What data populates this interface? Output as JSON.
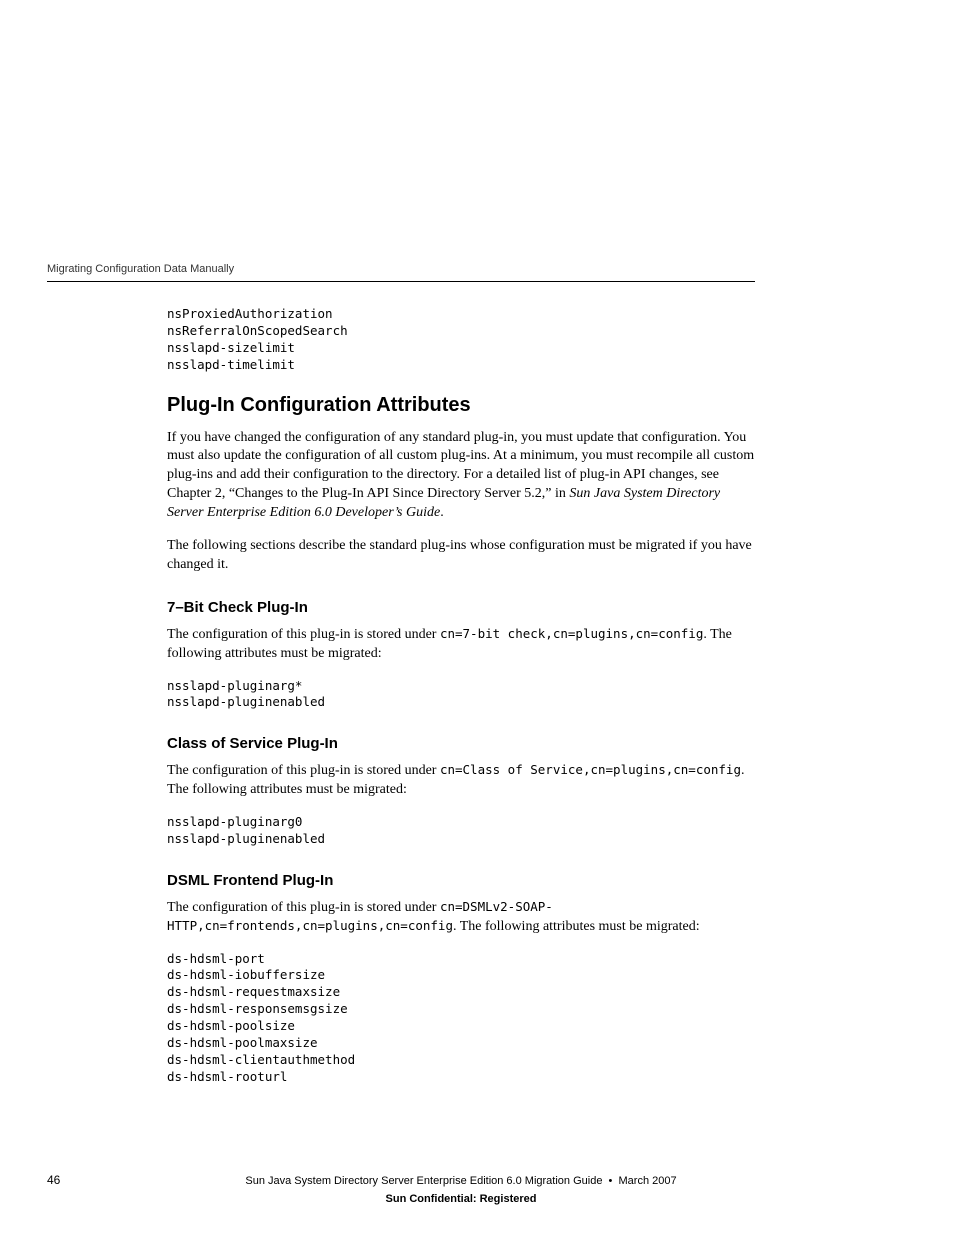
{
  "header": {
    "running_title": "Migrating Configuration Data Manually"
  },
  "top_code": "nsProxiedAuthorization\nnsReferralOnScopedSearch\nnsslapd-sizelimit\nnsslapd-timelimit",
  "section": {
    "title": "Plug-In Configuration Attributes",
    "para1": "If you have changed the configuration of any standard plug-in, you must update that configuration. You must also update the configuration of all custom plug-ins. At a minimum, you must recompile all custom plug-ins and add their configuration to the directory. For a detailed list of plug-in API changes, see Chapter 2, “Changes to the Plug-In API Since Directory Server 5.2,” in ",
    "para1_italic": "Sun Java System Directory Server Enterprise Edition 6.0 Developer’s Guide",
    "para1_tail": ".",
    "para2": "The following sections describe the standard plug-ins whose configuration must be migrated if you have changed it."
  },
  "sub1": {
    "title": "7–Bit Check Plug-In",
    "p_pre": "The configuration of this plug-in is stored under ",
    "p_code": "cn=7-bit check,cn=plugins,cn=config",
    "p_post": ". The following attributes must be migrated:",
    "code": "nsslapd-pluginarg*\nnsslapd-pluginenabled"
  },
  "sub2": {
    "title": "Class of Service Plug-In",
    "p_pre": "The configuration of this plug-in is stored under ",
    "p_code1": "cn=Class of Service,cn=plugins,cn=config",
    "p_post": ". The following attributes must be migrated:",
    "code": "nsslapd-pluginarg0\nnsslapd-pluginenabled"
  },
  "sub3": {
    "title": "DSML Frontend Plug-In",
    "p_pre": "The configuration of this plug-in is stored under ",
    "p_code": "cn=DSMLv2-SOAP-HTTP,cn=frontends,cn=plugins,cn=config",
    "p_post": ". The following attributes must be migrated:",
    "code": "ds-hdsml-port\nds-hdsml-iobuffersize\nds-hdsml-requestmaxsize\nds-hdsml-responsemsgsize\nds-hdsml-poolsize\nds-hdsml-poolmaxsize\nds-hdsml-clientauthmethod\nds-hdsml-rooturl"
  },
  "footer": {
    "page_number": "46",
    "doc_title": "Sun Java System Directory Server Enterprise Edition 6.0 Migration Guide  •  March 2007",
    "confidential": "Sun Confidential: Registered"
  }
}
